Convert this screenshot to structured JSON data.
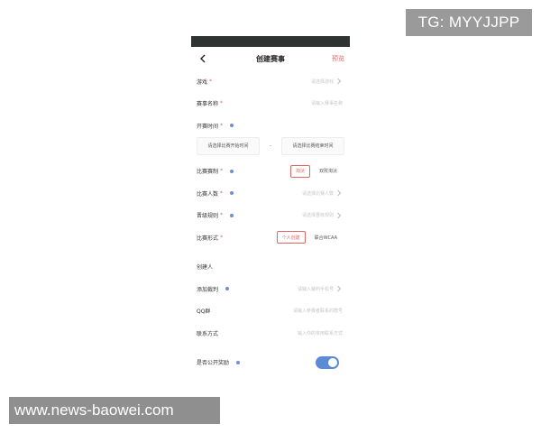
{
  "watermarks": {
    "top": "TG: MYYJJPP",
    "bottom": "www.news-baowei.com"
  },
  "nav": {
    "title": "创建赛事",
    "preview": "预览"
  },
  "colors": {
    "accent_red": "#e06666",
    "toggle_blue": "#5b8ad8",
    "info_dot": "#6f8fd0"
  },
  "form": {
    "game": {
      "label": "游戏",
      "required": "*",
      "placeholder": "请选择游戏"
    },
    "match_name": {
      "label": "赛事名称",
      "required": "*",
      "placeholder": "请输入赛事名称"
    },
    "start_time": {
      "label": "开赛时间",
      "required": "*",
      "start_placeholder": "请选择比赛开始时间",
      "dash": "-",
      "end_placeholder": "请选择比赛结束时间"
    },
    "match_format": {
      "label": "比赛赛制",
      "required": "*",
      "options": [
        "淘汰",
        "双败淘汰"
      ],
      "selected": "淘汰"
    },
    "player_count": {
      "label": "比赛人数",
      "required": "*",
      "placeholder": "请选择比赛人数"
    },
    "advance_rule": {
      "label": "晋级规则",
      "required": "*",
      "placeholder": "请选择晋级规则"
    },
    "match_type": {
      "label": "比赛形式",
      "required": "*",
      "options": [
        "个人创建",
        "联合WCAA"
      ],
      "selected": "个人创建"
    },
    "creator": {
      "label": "创建人"
    },
    "referee": {
      "label": "添加裁判",
      "placeholder": "请输入裁判手机号"
    },
    "qq_group": {
      "label": "QQ群",
      "placeholder": "请输入参赛者联系的群号"
    },
    "contact": {
      "label": "联系方式",
      "placeholder": "输入你的常用联系方式"
    },
    "public_reward": {
      "label": "是否公开奖励",
      "enabled": true
    }
  }
}
